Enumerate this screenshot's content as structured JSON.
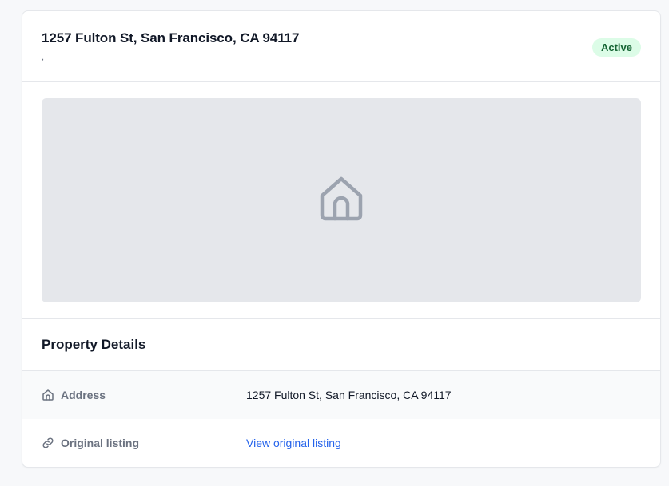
{
  "property": {
    "title": "1257 Fulton St, San Francisco, CA 94117",
    "subtitle": ",",
    "status": "Active"
  },
  "colors": {
    "status_bg": "#dcfce7",
    "status_text": "#166534",
    "link": "#2563eb",
    "placeholder_bg": "#e5e7eb",
    "placeholder_icon": "#9ca3af"
  },
  "icons": {
    "image_placeholder": "house-icon",
    "address": "house-icon",
    "listing": "link-icon"
  },
  "details": {
    "title": "Property Details",
    "rows": [
      {
        "label": "Address",
        "value": "1257 Fulton St, San Francisco, CA 94117"
      },
      {
        "label": "Original listing",
        "value": "View original listing"
      }
    ]
  }
}
